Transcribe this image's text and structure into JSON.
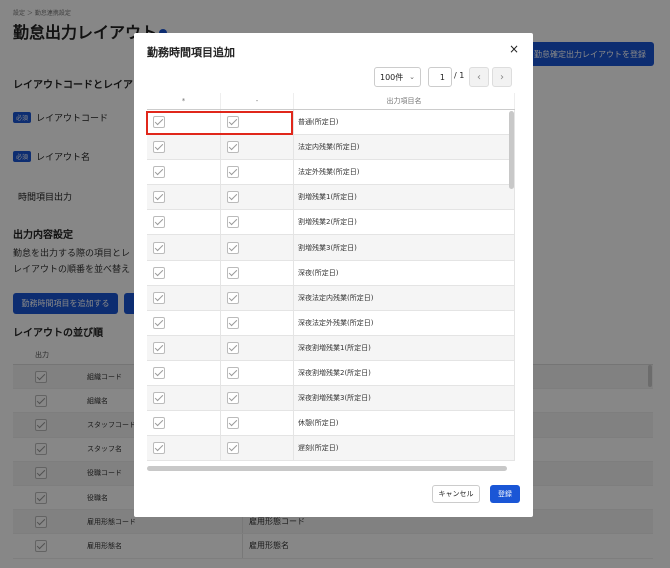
{
  "background": {
    "breadcrumb": "設定 ＞ 勤怠連携設定",
    "title": "勤怠出力レイアウト",
    "top_button": "勤怠確定出力レイアウトを登録",
    "section_code": "レイアウトコードとレイアウト",
    "required_badge": "必須",
    "field_code": "レイアウトコード",
    "field_name": "レイアウト名",
    "field_time": "時間項目出力",
    "section_output": "出力内容設定",
    "desc_line1": "勤怠を出力する際の項目とレ",
    "desc_line2": "レイアウトの順番を並べ替え",
    "add_button": "勤務時間項目を追加する",
    "section_order": "レイアウトの並び順",
    "order_header_output": "出力",
    "order_rows": [
      {
        "name": "組織コード",
        "value": ""
      },
      {
        "name": "組織名",
        "value": ""
      },
      {
        "name": "スタッフコード",
        "value": ""
      },
      {
        "name": "スタッフ名",
        "value": ""
      },
      {
        "name": "役職コード",
        "value": ""
      },
      {
        "name": "役職名",
        "value": ""
      },
      {
        "name": "雇用形態コード",
        "value": "雇用形態コード"
      },
      {
        "name": "雇用形態名",
        "value": "雇用形態名"
      }
    ]
  },
  "modal": {
    "title": "勤務時間項目追加",
    "close_label": "×",
    "per_page": "100件",
    "page_current": "1",
    "page_total": "/ 1",
    "prev_label": "‹",
    "next_label": "›",
    "headers": {
      "col1": "*",
      "col2": "-",
      "col3": "出力項目名"
    },
    "rows": [
      "普通(所定日)",
      "法定内残業(所定日)",
      "法定外残業(所定日)",
      "割増残業1(所定日)",
      "割増残業2(所定日)",
      "割増残業3(所定日)",
      "深夜(所定日)",
      "深夜法定内残業(所定日)",
      "深夜法定外残業(所定日)",
      "深夜割増残業1(所定日)",
      "深夜割増残業2(所定日)",
      "深夜割増残業3(所定日)",
      "休憩(所定日)",
      "遅刻(所定日)"
    ],
    "cancel_label": "キャンセル",
    "submit_label": "登録"
  },
  "colors": {
    "accent": "#1a56d6",
    "highlight": "#e0271b"
  }
}
